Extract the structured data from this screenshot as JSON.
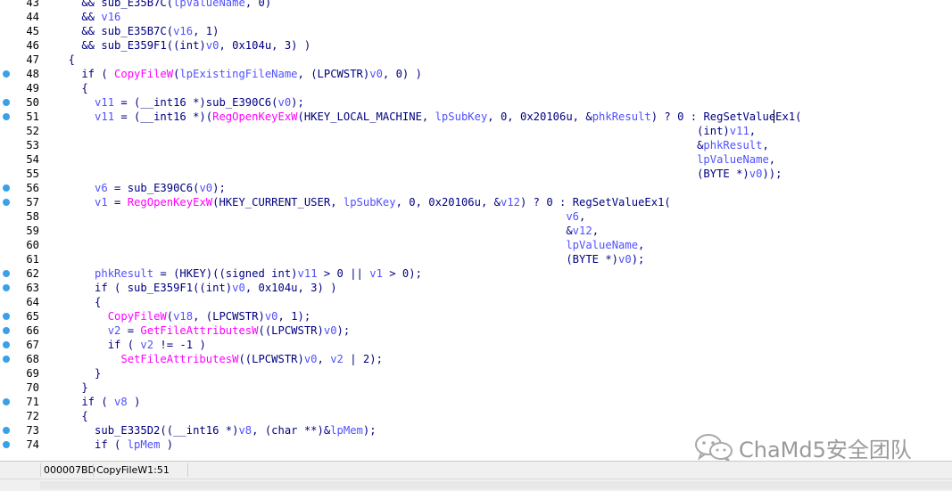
{
  "code_lines": [
    {
      "n": "43",
      "dot": false,
      "segs": [
        {
          "t": "    && ",
          "c": "k"
        },
        {
          "t": "sub_E35B7C",
          "c": "k"
        },
        {
          "t": "(",
          "c": "k"
        },
        {
          "t": "lpValueName",
          "c": "v"
        },
        {
          "t": ", 0)",
          "c": "k"
        }
      ]
    },
    {
      "n": "44",
      "dot": false,
      "segs": [
        {
          "t": "    && ",
          "c": "k"
        },
        {
          "t": "v16",
          "c": "v"
        }
      ]
    },
    {
      "n": "45",
      "dot": false,
      "segs": [
        {
          "t": "    && sub_E35B7C(",
          "c": "k"
        },
        {
          "t": "v16",
          "c": "v"
        },
        {
          "t": ", 1)",
          "c": "k"
        }
      ]
    },
    {
      "n": "46",
      "dot": false,
      "segs": [
        {
          "t": "    && sub_E359F1((int)",
          "c": "k"
        },
        {
          "t": "v0",
          "c": "v"
        },
        {
          "t": ", 0x104u, 3) )",
          "c": "k"
        }
      ]
    },
    {
      "n": "47",
      "dot": false,
      "segs": [
        {
          "t": "  {",
          "c": "k"
        }
      ]
    },
    {
      "n": "48",
      "dot": true,
      "segs": [
        {
          "t": "    if ( ",
          "c": "k"
        },
        {
          "t": "CopyFileW",
          "c": "f"
        },
        {
          "t": "(",
          "c": "k"
        },
        {
          "t": "lpExistingFileName",
          "c": "v"
        },
        {
          "t": ", (LPCWSTR)",
          "c": "k"
        },
        {
          "t": "v0",
          "c": "v"
        },
        {
          "t": ", 0) )",
          "c": "k"
        }
      ]
    },
    {
      "n": "49",
      "dot": false,
      "segs": [
        {
          "t": "    {",
          "c": "k"
        }
      ]
    },
    {
      "n": "50",
      "dot": true,
      "segs": [
        {
          "t": "      ",
          "c": "k"
        },
        {
          "t": "v11",
          "c": "v"
        },
        {
          "t": " = (__int16 *)sub_E390C6(",
          "c": "k"
        },
        {
          "t": "v0",
          "c": "v"
        },
        {
          "t": ");",
          "c": "k"
        }
      ]
    },
    {
      "n": "51",
      "dot": true,
      "segs": [
        {
          "t": "      ",
          "c": "k"
        },
        {
          "t": "v11",
          "c": "v"
        },
        {
          "t": " = (__int16 *)(",
          "c": "k"
        },
        {
          "t": "RegOpenKeyExW",
          "c": "f"
        },
        {
          "t": "(HKEY_LOCAL_MACHINE, ",
          "c": "k"
        },
        {
          "t": "lpSubKey",
          "c": "v"
        },
        {
          "t": ", 0, 0x20106u, &",
          "c": "k"
        },
        {
          "t": "phkResult",
          "c": "v"
        },
        {
          "t": ") ? 0 : RegSetValueEx1(",
          "c": "k"
        }
      ]
    },
    {
      "n": "52",
      "dot": false,
      "segs": [
        {
          "t": "                                                                                                  (int)",
          "c": "k"
        },
        {
          "t": "v11",
          "c": "v"
        },
        {
          "t": ",",
          "c": "k"
        }
      ]
    },
    {
      "n": "53",
      "dot": false,
      "segs": [
        {
          "t": "                                                                                                  &",
          "c": "k"
        },
        {
          "t": "phkResult",
          "c": "v"
        },
        {
          "t": ",",
          "c": "k"
        }
      ]
    },
    {
      "n": "54",
      "dot": false,
      "segs": [
        {
          "t": "                                                                                                  ",
          "c": "k"
        },
        {
          "t": "lpValueName",
          "c": "v"
        },
        {
          "t": ",",
          "c": "k"
        }
      ]
    },
    {
      "n": "55",
      "dot": false,
      "segs": [
        {
          "t": "                                                                                                  (BYTE *)",
          "c": "k"
        },
        {
          "t": "v0",
          "c": "v"
        },
        {
          "t": "));",
          "c": "k"
        }
      ]
    },
    {
      "n": "56",
      "dot": true,
      "segs": [
        {
          "t": "      ",
          "c": "k"
        },
        {
          "t": "v6",
          "c": "v"
        },
        {
          "t": " = sub_E390C6(",
          "c": "k"
        },
        {
          "t": "v0",
          "c": "v"
        },
        {
          "t": ");",
          "c": "k"
        }
      ]
    },
    {
      "n": "57",
      "dot": true,
      "segs": [
        {
          "t": "      ",
          "c": "k"
        },
        {
          "t": "v1",
          "c": "v"
        },
        {
          "t": " = ",
          "c": "k"
        },
        {
          "t": "RegOpenKeyExW",
          "c": "f"
        },
        {
          "t": "(HKEY_CURRENT_USER, ",
          "c": "k"
        },
        {
          "t": "lpSubKey",
          "c": "v"
        },
        {
          "t": ", 0, 0x20106u, &",
          "c": "k"
        },
        {
          "t": "v12",
          "c": "v"
        },
        {
          "t": ") ? 0 : RegSetValueEx1(",
          "c": "k"
        }
      ]
    },
    {
      "n": "58",
      "dot": false,
      "segs": [
        {
          "t": "                                                                              ",
          "c": "k"
        },
        {
          "t": "v6",
          "c": "v"
        },
        {
          "t": ",",
          "c": "k"
        }
      ]
    },
    {
      "n": "59",
      "dot": false,
      "segs": [
        {
          "t": "                                                                              &",
          "c": "k"
        },
        {
          "t": "v12",
          "c": "v"
        },
        {
          "t": ",",
          "c": "k"
        }
      ]
    },
    {
      "n": "60",
      "dot": false,
      "segs": [
        {
          "t": "                                                                              ",
          "c": "k"
        },
        {
          "t": "lpValueName",
          "c": "v"
        },
        {
          "t": ",",
          "c": "k"
        }
      ]
    },
    {
      "n": "61",
      "dot": false,
      "segs": [
        {
          "t": "                                                                              (BYTE *)",
          "c": "k"
        },
        {
          "t": "v0",
          "c": "v"
        },
        {
          "t": ");",
          "c": "k"
        }
      ]
    },
    {
      "n": "62",
      "dot": true,
      "segs": [
        {
          "t": "      ",
          "c": "k"
        },
        {
          "t": "phkResult",
          "c": "v"
        },
        {
          "t": " = (HKEY)((signed int)",
          "c": "k"
        },
        {
          "t": "v11",
          "c": "v"
        },
        {
          "t": " > 0 || ",
          "c": "k"
        },
        {
          "t": "v1",
          "c": "v"
        },
        {
          "t": " > 0);",
          "c": "k"
        }
      ]
    },
    {
      "n": "63",
      "dot": true,
      "segs": [
        {
          "t": "      if ( sub_E359F1((int)",
          "c": "k"
        },
        {
          "t": "v0",
          "c": "v"
        },
        {
          "t": ", 0x104u, 3) )",
          "c": "k"
        }
      ]
    },
    {
      "n": "64",
      "dot": false,
      "segs": [
        {
          "t": "      {",
          "c": "k"
        }
      ]
    },
    {
      "n": "65",
      "dot": true,
      "segs": [
        {
          "t": "        ",
          "c": "k"
        },
        {
          "t": "CopyFileW",
          "c": "f"
        },
        {
          "t": "(",
          "c": "k"
        },
        {
          "t": "v18",
          "c": "v"
        },
        {
          "t": ", (LPCWSTR)",
          "c": "k"
        },
        {
          "t": "v0",
          "c": "v"
        },
        {
          "t": ", 1);",
          "c": "k"
        }
      ]
    },
    {
      "n": "66",
      "dot": true,
      "segs": [
        {
          "t": "        ",
          "c": "k"
        },
        {
          "t": "v2",
          "c": "v"
        },
        {
          "t": " = ",
          "c": "k"
        },
        {
          "t": "GetFileAttributesW",
          "c": "f"
        },
        {
          "t": "((LPCWSTR)",
          "c": "k"
        },
        {
          "t": "v0",
          "c": "v"
        },
        {
          "t": ");",
          "c": "k"
        }
      ]
    },
    {
      "n": "67",
      "dot": true,
      "segs": [
        {
          "t": "        if ( ",
          "c": "k"
        },
        {
          "t": "v2",
          "c": "v"
        },
        {
          "t": " != -1 )",
          "c": "k"
        }
      ]
    },
    {
      "n": "68",
      "dot": true,
      "segs": [
        {
          "t": "          ",
          "c": "k"
        },
        {
          "t": "SetFileAttributesW",
          "c": "f"
        },
        {
          "t": "((LPCWSTR)",
          "c": "k"
        },
        {
          "t": "v0",
          "c": "v"
        },
        {
          "t": ", ",
          "c": "k"
        },
        {
          "t": "v2",
          "c": "v"
        },
        {
          "t": " | 2);",
          "c": "k"
        }
      ]
    },
    {
      "n": "69",
      "dot": false,
      "segs": [
        {
          "t": "      }",
          "c": "k"
        }
      ]
    },
    {
      "n": "70",
      "dot": false,
      "segs": [
        {
          "t": "    }",
          "c": "k"
        }
      ]
    },
    {
      "n": "71",
      "dot": true,
      "segs": [
        {
          "t": "    if ( ",
          "c": "k"
        },
        {
          "t": "v8",
          "c": "v"
        },
        {
          "t": " )",
          "c": "k"
        }
      ]
    },
    {
      "n": "72",
      "dot": false,
      "segs": [
        {
          "t": "    {",
          "c": "k"
        }
      ]
    },
    {
      "n": "73",
      "dot": true,
      "segs": [
        {
          "t": "      sub_E335D2((__int16 *)",
          "c": "k"
        },
        {
          "t": "v8",
          "c": "v"
        },
        {
          "t": ", (char **)&",
          "c": "k"
        },
        {
          "t": "lpMem",
          "c": "v"
        },
        {
          "t": ");",
          "c": "k"
        }
      ]
    },
    {
      "n": "74",
      "dot": true,
      "segs": [
        {
          "t": "      if ( ",
          "c": "k"
        },
        {
          "t": "lpMem",
          "c": "v"
        },
        {
          "t": " )",
          "c": "k"
        }
      ]
    }
  ],
  "status": {
    "address": "000007BD",
    "location": "CopyFileW1:51"
  },
  "watermark": {
    "text": "ChaMd5安全团队",
    "icon": "wechat-icon"
  },
  "colors": {
    "text": "#000080",
    "function": "#ff00ff",
    "variable": "#5050ff",
    "breakpoint_dot": "#3aa0e8"
  }
}
